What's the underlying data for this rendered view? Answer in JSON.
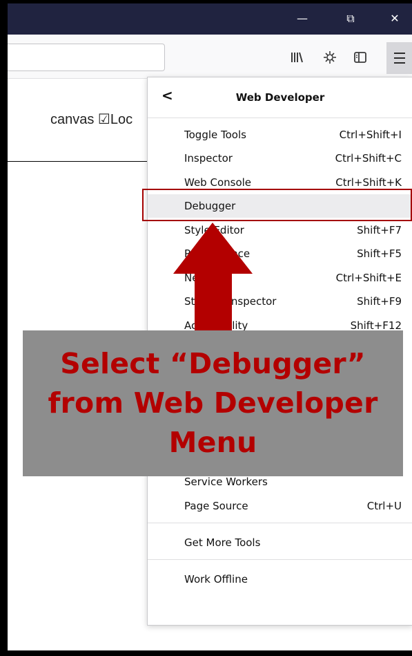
{
  "window": {
    "controls": {
      "minimize": "—",
      "restore": "⧉",
      "close": "✕"
    }
  },
  "toolbar": {
    "icons": [
      "library-icon",
      "extension-icon",
      "sidebar-icon",
      "hamburger-menu-icon"
    ]
  },
  "content": {
    "text": "canvas ☑Loc"
  },
  "menu": {
    "back": "<",
    "title": "Web Developer",
    "items": [
      {
        "label": "Toggle Tools",
        "shortcut": "Ctrl+Shift+I"
      },
      {
        "label": "Inspector",
        "shortcut": "Ctrl+Shift+C"
      },
      {
        "label": "Web Console",
        "shortcut": "Ctrl+Shift+K"
      },
      {
        "label": "Debugger",
        "shortcut": ""
      },
      {
        "label": "Style Editor",
        "shortcut": "Shift+F7"
      },
      {
        "label": "Performance",
        "shortcut": "Shift+F5"
      },
      {
        "label": "Network",
        "shortcut": "Ctrl+Shift+E"
      },
      {
        "label": "Storage Inspector",
        "shortcut": "Shift+F9"
      },
      {
        "label": "Accessibility",
        "shortcut": "Shift+F12"
      }
    ],
    "items_lower": [
      {
        "label": "Service Workers",
        "shortcut": ""
      },
      {
        "label": "Page Source",
        "shortcut": "Ctrl+U"
      }
    ],
    "get_more": "Get More Tools",
    "work_offline": "Work Offline"
  },
  "annotation": {
    "callout": "Select “Debugger”\nfrom Web Developer\nMenu",
    "colors": {
      "text": "#b30000",
      "box": "#8d8d8d",
      "arrow": "#b30000",
      "highlight_border": "#a40000"
    }
  }
}
